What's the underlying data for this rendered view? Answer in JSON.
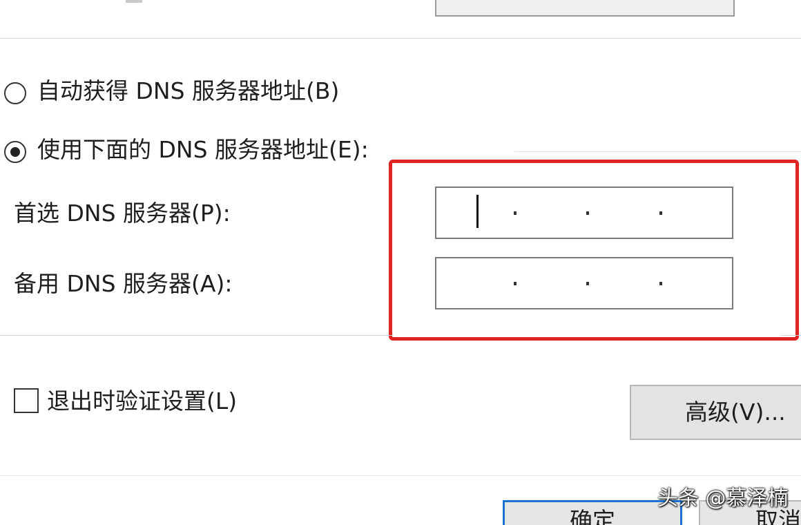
{
  "dns_section": {
    "auto_label": "自动获得 DNS 服务器地址(B)",
    "manual_label": "使用下面的 DNS 服务器地址(E):",
    "selected": "manual",
    "preferred_label": "首选 DNS 服务器(P):",
    "alternate_label": "备用 DNS 服务器(A):",
    "preferred_value": ". . .",
    "alternate_value": ". . ."
  },
  "footer": {
    "validate_label": "退出时验证设置(L)",
    "validate_checked": false,
    "advanced_label": "高级(V)...",
    "ok_label": "确定",
    "cancel_label": "取消"
  },
  "watermark": "头条 @慕泽楠",
  "colors": {
    "highlight": "#e02424",
    "ok_border": "#1a73d0"
  }
}
